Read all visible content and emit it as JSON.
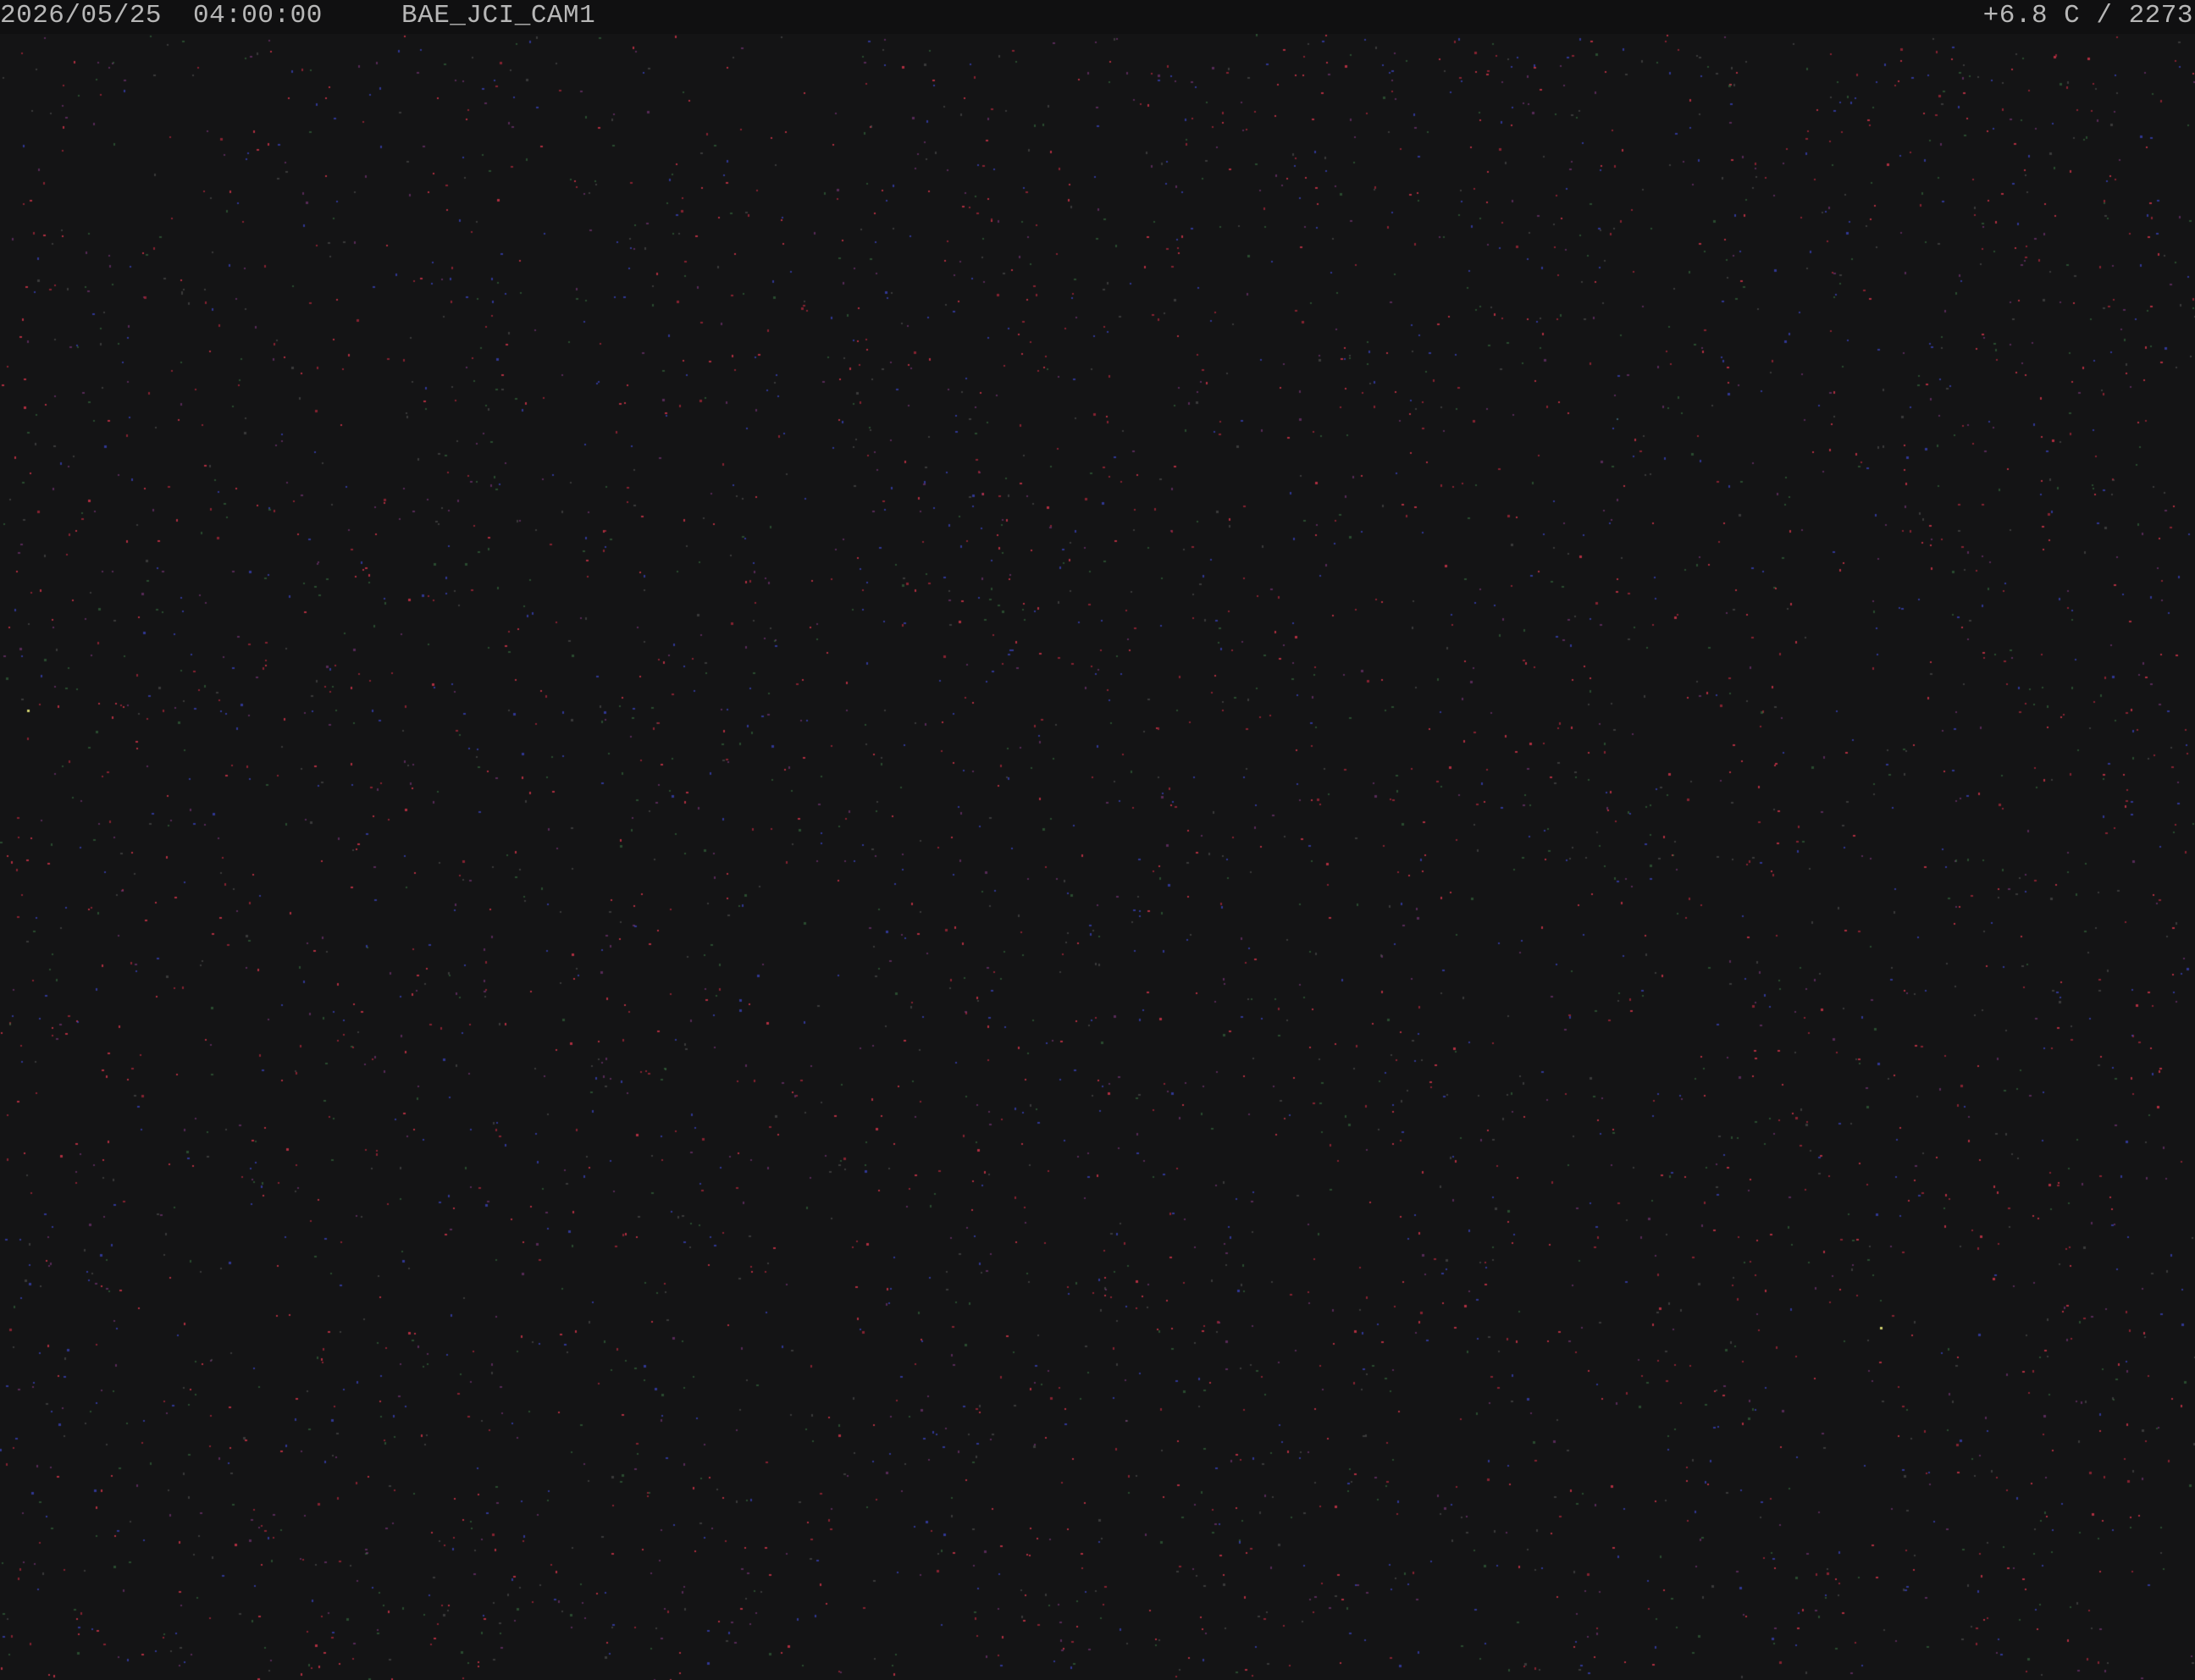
{
  "osd": {
    "date": "2026/05/25",
    "time": "04:00:00",
    "camera_id": "BAE_JCI_CAM1",
    "temperature_readout": "+6.8 C / 2273"
  },
  "colors": {
    "background": "#141415",
    "osd_text": "#b7b7b7",
    "osd_bar": "#101011"
  }
}
